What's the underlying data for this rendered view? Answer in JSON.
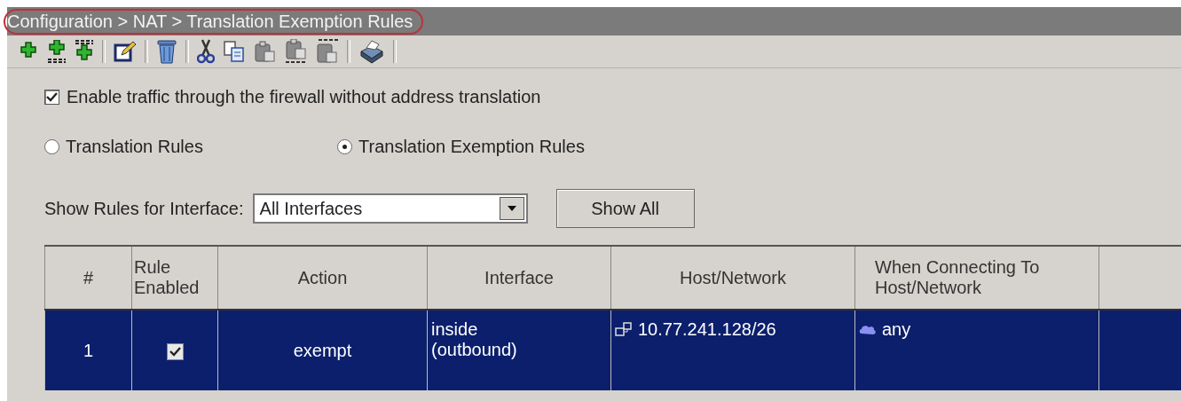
{
  "breadcrumb": "Configuration > NAT > Translation Exemption Rules",
  "enable_traffic": {
    "label": "Enable traffic through the firewall without address translation",
    "checked": true
  },
  "rule_types": [
    {
      "label": "Translation Rules",
      "selected": false
    },
    {
      "label": "Translation Exemption Rules",
      "selected": true
    }
  ],
  "interface_filter": {
    "label": "Show Rules for Interface:",
    "value": "All Interfaces"
  },
  "show_all_button": "Show All",
  "table": {
    "columns": [
      "#",
      "Rule\nEnabled",
      "Action",
      "Interface",
      "Host/Network",
      "When Connecting To\nHost/Network"
    ],
    "rows": [
      {
        "number": "1",
        "enabled": true,
        "action": "exempt",
        "interface": "inside\n(outbound)",
        "host_network": "10.77.241.128/26",
        "connecting_to": "any",
        "selected": true
      }
    ]
  }
}
